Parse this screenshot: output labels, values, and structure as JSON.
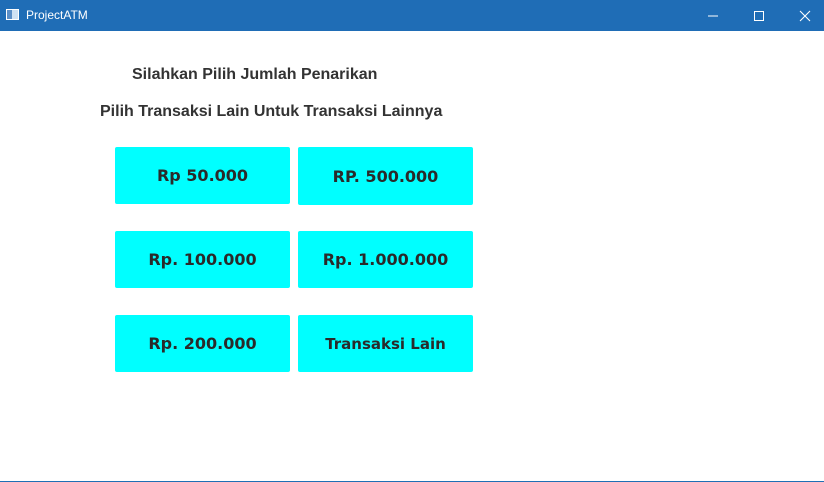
{
  "window": {
    "title": "ProjectATM",
    "icons": {
      "app": "app-window-icon",
      "minimize": "minimize-icon",
      "maximize": "maximize-icon",
      "close": "close-icon"
    },
    "colors": {
      "titlebar": "#1f6db6",
      "button": "#00ffff",
      "heading_text": "#333333"
    }
  },
  "main": {
    "heading": "Silahkan Pilih Jumlah Penarikan",
    "subheading": "Pilih Transaksi Lain Untuk Transaksi Lainnya",
    "buttons": [
      {
        "label": "Rp 50.000"
      },
      {
        "label": "RP. 500.000"
      },
      {
        "label": "Rp. 100.000"
      },
      {
        "label": "Rp. 1.000.000"
      },
      {
        "label": "Rp. 200.000"
      },
      {
        "label": "Transaksi Lain"
      }
    ]
  }
}
